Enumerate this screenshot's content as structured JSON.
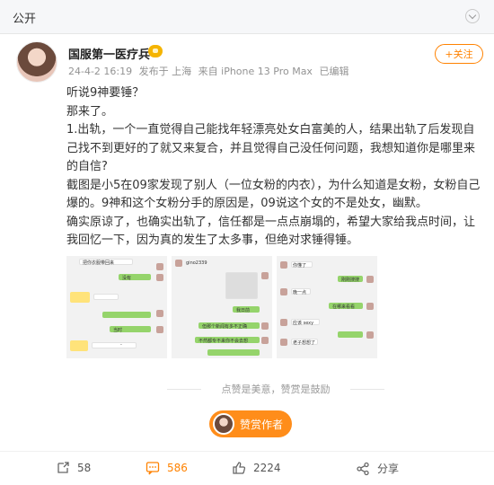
{
  "header": {
    "visibility": "公开"
  },
  "post": {
    "author": "国服第一医疗兵",
    "meta": {
      "time": "24-4-2 16:19",
      "location": "发布于 上海",
      "device": "来自 iPhone 13 Pro Max",
      "edited": "已编辑"
    },
    "follow_label": "+关注",
    "paragraphs": [
      "听说9神要锤？",
      "那来了。",
      "1.出轨，一个一直觉得自己能找年轻漂亮处女白富美的人，结果出轨了后发现自己找不到更好的了就又来复合，并且觉得自己没任何问题，我想知道你是哪里来的自信?",
      "截图是小5在09家发现了别人（一位女粉的内衣），为什么知道是女粉，女粉自己爆的。9神和这个女粉分手的原因是，09说这个女的不是处女，幽默。",
      "确实原谅了，也确实出轨了，信任都是一点点崩塌的，希望大家给我点时间，让我回忆一下，因为真的发生了太多事，但绝对求锤得锤。"
    ],
    "images": [
      {
        "texts": [
          "把你衣服带回来",
          "没有",
          "当时",
          "-"
        ]
      },
      {
        "texts": [
          "gino2339",
          "我日前",
          "但那个新闻有多不正确",
          "不然都专不来你不会去想"
        ]
      },
      {
        "texts": [
          "你懂了",
          "刚刚搜搜",
          "晚一点",
          "在哪来看看",
          "应该 sexy",
          "老子想想了"
        ]
      }
    ],
    "praise_line": "点赞是美意，赞赏是鼓励",
    "reward_label": "赞赏作者"
  },
  "actions": {
    "forward_count": "58",
    "comment_count": "586",
    "like_count": "2224",
    "share_label": "分享"
  },
  "colors": {
    "accent": "#ff8200",
    "reward": "#ff8d1a",
    "chat_green": "#95d46b"
  }
}
